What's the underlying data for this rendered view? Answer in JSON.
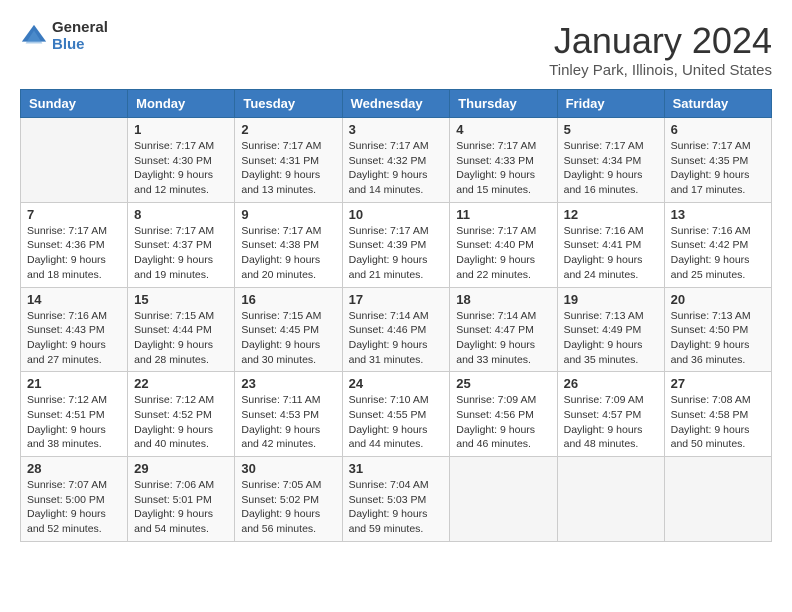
{
  "header": {
    "logo_general": "General",
    "logo_blue": "Blue",
    "month_title": "January 2024",
    "location": "Tinley Park, Illinois, United States"
  },
  "days_of_week": [
    "Sunday",
    "Monday",
    "Tuesday",
    "Wednesday",
    "Thursday",
    "Friday",
    "Saturday"
  ],
  "weeks": [
    [
      {
        "date": "",
        "info": ""
      },
      {
        "date": "1",
        "info": "Sunrise: 7:17 AM\nSunset: 4:30 PM\nDaylight: 9 hours\nand 12 minutes."
      },
      {
        "date": "2",
        "info": "Sunrise: 7:17 AM\nSunset: 4:31 PM\nDaylight: 9 hours\nand 13 minutes."
      },
      {
        "date": "3",
        "info": "Sunrise: 7:17 AM\nSunset: 4:32 PM\nDaylight: 9 hours\nand 14 minutes."
      },
      {
        "date": "4",
        "info": "Sunrise: 7:17 AM\nSunset: 4:33 PM\nDaylight: 9 hours\nand 15 minutes."
      },
      {
        "date": "5",
        "info": "Sunrise: 7:17 AM\nSunset: 4:34 PM\nDaylight: 9 hours\nand 16 minutes."
      },
      {
        "date": "6",
        "info": "Sunrise: 7:17 AM\nSunset: 4:35 PM\nDaylight: 9 hours\nand 17 minutes."
      }
    ],
    [
      {
        "date": "7",
        "info": "Sunrise: 7:17 AM\nSunset: 4:36 PM\nDaylight: 9 hours\nand 18 minutes."
      },
      {
        "date": "8",
        "info": "Sunrise: 7:17 AM\nSunset: 4:37 PM\nDaylight: 9 hours\nand 19 minutes."
      },
      {
        "date": "9",
        "info": "Sunrise: 7:17 AM\nSunset: 4:38 PM\nDaylight: 9 hours\nand 20 minutes."
      },
      {
        "date": "10",
        "info": "Sunrise: 7:17 AM\nSunset: 4:39 PM\nDaylight: 9 hours\nand 21 minutes."
      },
      {
        "date": "11",
        "info": "Sunrise: 7:17 AM\nSunset: 4:40 PM\nDaylight: 9 hours\nand 22 minutes."
      },
      {
        "date": "12",
        "info": "Sunrise: 7:16 AM\nSunset: 4:41 PM\nDaylight: 9 hours\nand 24 minutes."
      },
      {
        "date": "13",
        "info": "Sunrise: 7:16 AM\nSunset: 4:42 PM\nDaylight: 9 hours\nand 25 minutes."
      }
    ],
    [
      {
        "date": "14",
        "info": "Sunrise: 7:16 AM\nSunset: 4:43 PM\nDaylight: 9 hours\nand 27 minutes."
      },
      {
        "date": "15",
        "info": "Sunrise: 7:15 AM\nSunset: 4:44 PM\nDaylight: 9 hours\nand 28 minutes."
      },
      {
        "date": "16",
        "info": "Sunrise: 7:15 AM\nSunset: 4:45 PM\nDaylight: 9 hours\nand 30 minutes."
      },
      {
        "date": "17",
        "info": "Sunrise: 7:14 AM\nSunset: 4:46 PM\nDaylight: 9 hours\nand 31 minutes."
      },
      {
        "date": "18",
        "info": "Sunrise: 7:14 AM\nSunset: 4:47 PM\nDaylight: 9 hours\nand 33 minutes."
      },
      {
        "date": "19",
        "info": "Sunrise: 7:13 AM\nSunset: 4:49 PM\nDaylight: 9 hours\nand 35 minutes."
      },
      {
        "date": "20",
        "info": "Sunrise: 7:13 AM\nSunset: 4:50 PM\nDaylight: 9 hours\nand 36 minutes."
      }
    ],
    [
      {
        "date": "21",
        "info": "Sunrise: 7:12 AM\nSunset: 4:51 PM\nDaylight: 9 hours\nand 38 minutes."
      },
      {
        "date": "22",
        "info": "Sunrise: 7:12 AM\nSunset: 4:52 PM\nDaylight: 9 hours\nand 40 minutes."
      },
      {
        "date": "23",
        "info": "Sunrise: 7:11 AM\nSunset: 4:53 PM\nDaylight: 9 hours\nand 42 minutes."
      },
      {
        "date": "24",
        "info": "Sunrise: 7:10 AM\nSunset: 4:55 PM\nDaylight: 9 hours\nand 44 minutes."
      },
      {
        "date": "25",
        "info": "Sunrise: 7:09 AM\nSunset: 4:56 PM\nDaylight: 9 hours\nand 46 minutes."
      },
      {
        "date": "26",
        "info": "Sunrise: 7:09 AM\nSunset: 4:57 PM\nDaylight: 9 hours\nand 48 minutes."
      },
      {
        "date": "27",
        "info": "Sunrise: 7:08 AM\nSunset: 4:58 PM\nDaylight: 9 hours\nand 50 minutes."
      }
    ],
    [
      {
        "date": "28",
        "info": "Sunrise: 7:07 AM\nSunset: 5:00 PM\nDaylight: 9 hours\nand 52 minutes."
      },
      {
        "date": "29",
        "info": "Sunrise: 7:06 AM\nSunset: 5:01 PM\nDaylight: 9 hours\nand 54 minutes."
      },
      {
        "date": "30",
        "info": "Sunrise: 7:05 AM\nSunset: 5:02 PM\nDaylight: 9 hours\nand 56 minutes."
      },
      {
        "date": "31",
        "info": "Sunrise: 7:04 AM\nSunset: 5:03 PM\nDaylight: 9 hours\nand 59 minutes."
      },
      {
        "date": "",
        "info": ""
      },
      {
        "date": "",
        "info": ""
      },
      {
        "date": "",
        "info": ""
      }
    ]
  ]
}
